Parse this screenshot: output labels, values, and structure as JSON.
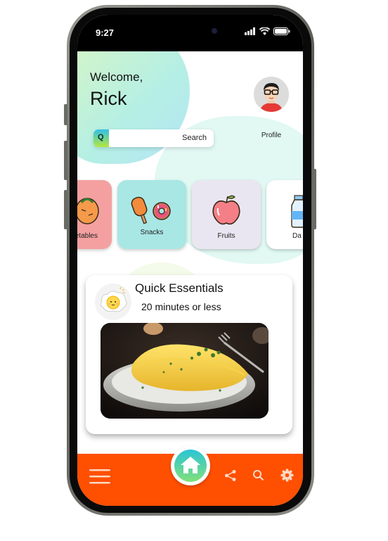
{
  "status_bar": {
    "time": "9:27"
  },
  "header": {
    "greeting": "Welcome,",
    "user_name": "Rick"
  },
  "profile": {
    "label": "Profile"
  },
  "search": {
    "icon_letter": "Q",
    "label": "Search"
  },
  "categories": [
    {
      "label": "etables",
      "icon": "vegetables-icon",
      "color": "#f4a0a0"
    },
    {
      "label": "Snacks",
      "icon": "snacks-icon",
      "color": "#a8e7e4"
    },
    {
      "label": "Fruits",
      "icon": "apple-icon",
      "color": "#eae6f1"
    },
    {
      "label": "Da",
      "icon": "milk-icon",
      "color": "#ffffff"
    }
  ],
  "quick_card": {
    "title": "Quick Essentials",
    "subtitle": "20 minutes or less",
    "icon": "fried-egg-icon",
    "image": "omelette-photo"
  },
  "bottom_nav": {
    "accent_color": "#ff4f00",
    "items": [
      "menu-icon",
      "home-icon",
      "share-icon",
      "search-icon",
      "settings-icon"
    ]
  }
}
